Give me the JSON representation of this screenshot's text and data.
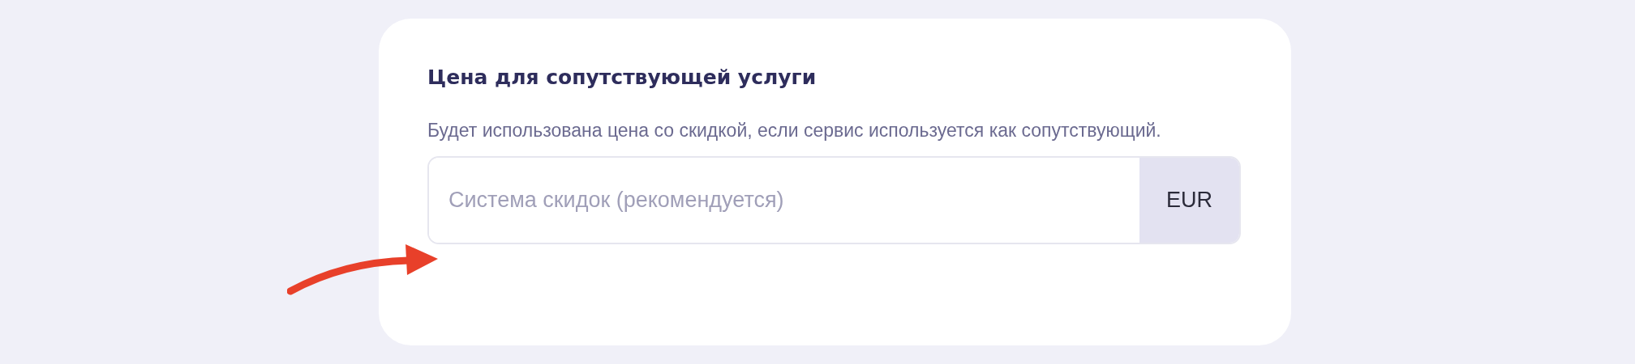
{
  "card": {
    "title": "Цена для сопутствующей услуги",
    "description": "Будет использована цена со скидкой, если сервис используется как сопутствующий.",
    "price_field": {
      "placeholder": "Система скидок (рекомендуется)",
      "currency": "EUR"
    }
  }
}
